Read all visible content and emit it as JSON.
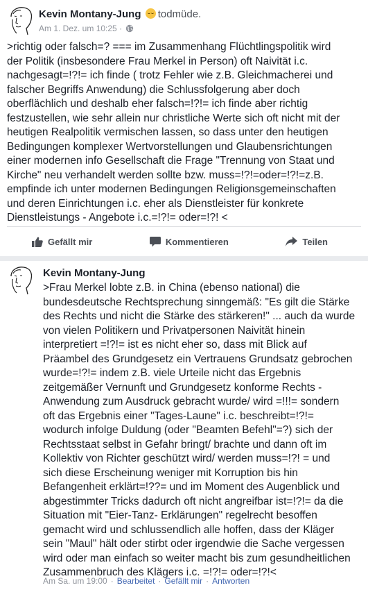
{
  "post": {
    "author": "Kevin Montany-Jung",
    "feeling_icon": "sleepy-face-emoji",
    "feeling": "todmüde.",
    "timestamp": "Am 1. Dez. um 10:25",
    "separator": "·",
    "privacy_icon": "globe-icon",
    "text": ">richtig oder falsch=? === im Zusammenhang Flüchtlingspolitik wird\nder Politik (insbesondere Frau Merkel in Person) oft Naivität i.c.\nnachgesagt=!?!= ich finde ( trotz Fehler wie z.B. Gleichmacherei und\nfalscher Begriffs Anwendung) die  Schlussfolgerung aber doch\noberflächlich und deshalb eher falsch=!?!= ich finde aber richtig\nfestzustellen, wie sehr allein nur christliche Werte sich oft nicht mit der\nheutigen Realpolitik vermischen lassen, so dass unter den heutigen\nBedingungen komplexer Wertvorstellungen und Glaubensrichtungen\neiner modernen info Gesellschaft die Frage \"Trennung von  Staat und\nKirche\" neu verhandelt werden sollte bzw. muss=!?!=oder=!?!=z.B.\nempfinde ich unter modernen Bedingungen Religionsgemeinschaften\nund deren Einrichtungen i.c. eher als Dienstleister für konkrete\nDienstleistungs - Angebote i.c.=!?!= oder=!?! <"
  },
  "actions": {
    "like_label": "Gefällt mir",
    "comment_label": "Kommentieren",
    "share_label": "Teilen"
  },
  "comment": {
    "author": "Kevin Montany-Jung",
    "text": ">Frau Merkel lobte z.B. in China (ebenso national) die\nbundesdeutsche Rechtsprechung sinngemäß: \"Es gilt die Stärke\ndes Rechts und nicht die Stärke des stärkeren!\" ... auch da wurde\nvon vielen Politikern und Privatpersonen Naivität hinein\ninterpretiert =!?!= ist es nicht eher so, dass mit Blick auf\nPräambel des  Grundgesetz ein Vertrauens Grundsatz gebrochen\nwurde=!?!=  indem z.B. viele Urteile nicht das Ergebnis\nzeitgemäßer Vernunft und Grundgesetz konforme Rechts -\nAnwendung zum Ausdruck gebracht wurde/ wird =!!!= sondern\noft das Ergebnis  einer \"Tages-Laune\" i.c. beschreibt=!?!=\nwodurch infolge Duldung (oder \"Beamten Befehl\"=?) sich der\nRechtsstaat selbst in Gefahr bringt/ brachte und dann oft im\nKollektiv von Richter  geschützt wird/ werden muss=!?! = und\nsich diese Erscheinung weniger mit Korruption bis hin\nBefangenheit  erklärt=!??= und im Moment des Augenblick und\nabgestimmter Tricks dadurch oft nicht angreifbar ist=!?!= da die\nSituation mit \"Eier-Tanz- Erklärungen\" regelrecht besoffen\ngemacht wird und schlussendlich alle hoffen, dass der Kläger\nsein \"Maul\" hält oder stirbt oder irgendwie die Sache vergessen\nwird oder man einfach so weiter macht bis zum gesundheitlichen\nZusammenbruch des Klägers i.c. =!?!= oder=!?!<",
    "timestamp": "Am Sa. um 19:00",
    "edited_label": "Bearbeitet",
    "like_label": "Gefällt mir",
    "reply_label": "Antworten",
    "separator": "·"
  }
}
